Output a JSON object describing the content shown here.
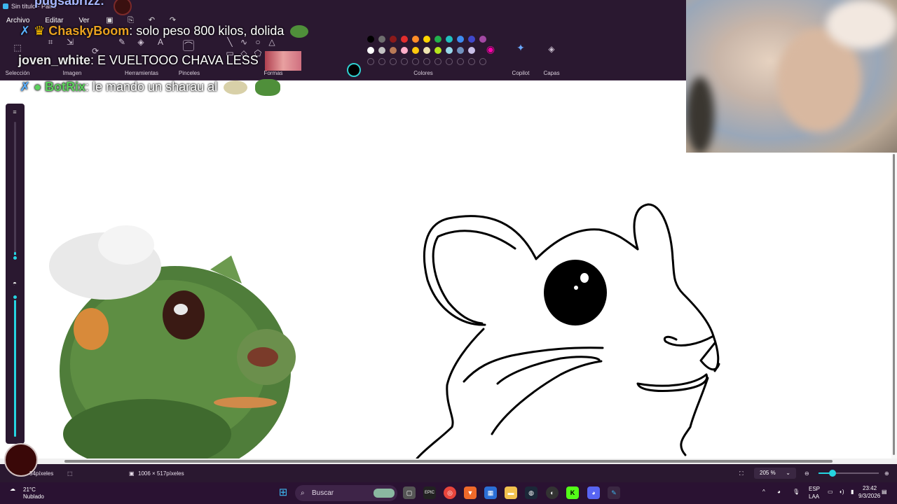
{
  "app": {
    "title": "Sin título - Paint",
    "menu": [
      "Archivo",
      "Editar",
      "Ver"
    ]
  },
  "ribbon": {
    "groups": [
      "Selección",
      "Imagen",
      "Herramientas",
      "Pinceles",
      "Formas",
      "Colores",
      "Copilot",
      "Capas"
    ],
    "palette_row1": [
      "#000000",
      "#6e6e6e",
      "#8b1a1a",
      "#e22d2d",
      "#ff8c28",
      "#ffd400",
      "#22b14c",
      "#20c0c0",
      "#3d8bf0",
      "#3f48cc",
      "#a349a4"
    ],
    "palette_row2": [
      "#ffffff",
      "#c3c3c3",
      "#b97a57",
      "#ffaec9",
      "#ffc90e",
      "#efe4b0",
      "#b5e61d",
      "#99d9ea",
      "#7092be",
      "#c8bfe7"
    ],
    "current_color_1": "#000000",
    "current_color_2": "#ffffff"
  },
  "chat": [
    {
      "user": "pugsabrizz:",
      "message": "",
      "user_color": "#a8b8ff"
    },
    {
      "user": "ChaskyBoom",
      "message": ": solo peso 800 kilos, dolida",
      "user_color": "#e8a020"
    },
    {
      "user": "joven_white",
      "message": ": E VUELTOOO CHAVA LESS",
      "user_color": "#e8e8e8"
    },
    {
      "user": "BotRix",
      "message": ": le mando un sharau al",
      "user_color": "#5dd05d"
    }
  ],
  "status": {
    "cursor_position": "54píxeles",
    "canvas_size": "1006 × 517píxeles",
    "zoom": "205 %"
  },
  "taskbar": {
    "weather_temp": "21°C",
    "weather_desc": "Nublado",
    "search_placeholder": "Buscar",
    "language": "ESP",
    "language_region": "LAA",
    "time": "23:42",
    "date": "9/3/2026"
  }
}
